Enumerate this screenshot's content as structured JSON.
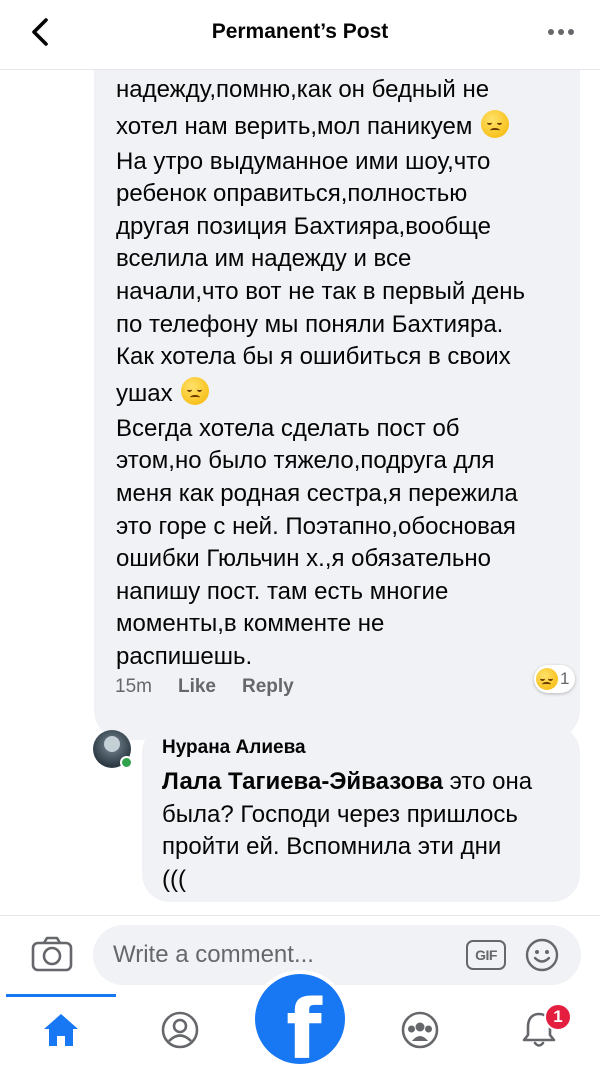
{
  "header": {
    "title": "Permanent’s Post",
    "back_icon": "chevron-left-icon",
    "more_icon": "more-horizontal-icon"
  },
  "comment1": {
    "lines": [
      "надежду,помню,как он бедный не",
      "хотел нам верить,мол паникуем",
      "На утро выдуманное ими шоу,что",
      "ребенок оправиться,полностью",
      "другая позиция Бахтияра,вообще",
      "вселила им надежду и все",
      "начали,что вот не так в первый день",
      "по телефону мы поняли Бахтияра.",
      "Как хотела бы я ошибиться в своих",
      "ушах",
      "Всегда хотела сделать пост об",
      "этом,но было тяжело,подруга для",
      "меня как родная сестра,я пережила",
      "это горе с ней. Поэтапно,обосновая",
      "ошибки Гюльчин х.,я обязательно",
      "напишу пост. там есть многие",
      "моменты,в комменте не",
      "распишешь."
    ],
    "time": "15m",
    "like_label": "Like",
    "reply_label": "Reply",
    "reaction_icon": "sad-tear-emoji-icon",
    "reaction_count": "1"
  },
  "comment2": {
    "author": "Нурана Алиева",
    "mention": "Лала Тагиева-Эйвазова",
    "line1_rest": " это она",
    "lines": [
      "была? Господи через пришлось",
      "пройти ей. Вспомнила эти дни",
      "((("
    ]
  },
  "composer": {
    "placeholder": "Write a comment...",
    "camera_icon": "camera-icon",
    "gif_label": "GIF",
    "emoji_icon": "smiley-icon"
  },
  "tabbar": {
    "tabs": [
      "home-icon",
      "profile-icon",
      "facebook-icon",
      "groups-icon",
      "notifications-icon"
    ],
    "fab_letter": "f",
    "notification_badge": "1",
    "accent_color": "#1877f2"
  }
}
